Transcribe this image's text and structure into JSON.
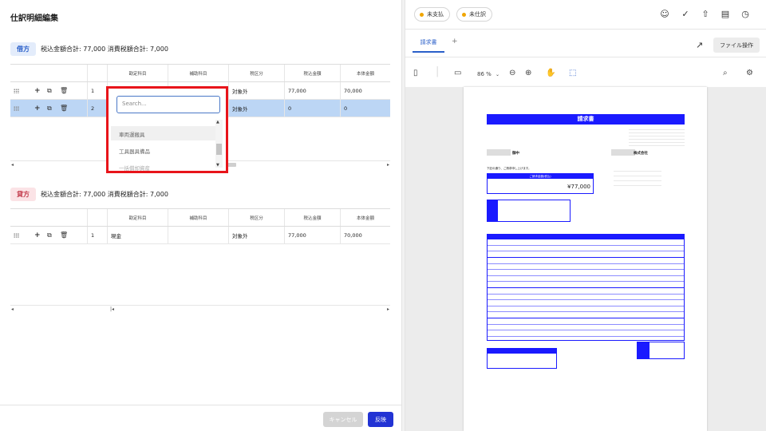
{
  "dialog": {
    "title": "仕訳明細編集",
    "cancel_label": "キャンセル",
    "apply_label": "反映"
  },
  "debit": {
    "badge": "借方",
    "summary": "税込金額合計: 77,000 消費税額合計: 7,000",
    "headers": [
      "勘定科目",
      "補助科目",
      "税区分",
      "税込金額",
      "本体金額"
    ],
    "rows": [
      {
        "no": "1",
        "account": "",
        "sub": "",
        "tax": "対象外",
        "amount": "77,000",
        "base": "70,000"
      },
      {
        "no": "2",
        "account": "",
        "sub": "",
        "tax": "対象外",
        "amount": "0",
        "base": "0"
      }
    ]
  },
  "credit": {
    "badge": "貸方",
    "summary": "税込金額合計: 77,000 消費税額合計: 7,000",
    "headers": [
      "勘定科目",
      "補助科目",
      "税区分",
      "税込金額",
      "本体金額"
    ],
    "rows": [
      {
        "no": "1",
        "account": "現金",
        "sub": "",
        "tax": "対象外",
        "amount": "77,000",
        "base": "70,000"
      }
    ]
  },
  "dropdown": {
    "placeholder": "Search...",
    "options": [
      "車両運搬具",
      "工具器具備品",
      "一括償却資産"
    ]
  },
  "viewer": {
    "chips": [
      "未支払",
      "未仕訳"
    ],
    "tab_label": "請求書",
    "file_ops_label": "ファイル操作",
    "zoom": "86 %",
    "document": {
      "title": "請求書",
      "recipient_suffix": "御中",
      "sender": "株式会社",
      "greeting": "下記の通り、ご請求申し上げます。",
      "amount_label": "ご請求金額(税込)",
      "amount": "¥77,000"
    }
  },
  "colors": {
    "accent": "#2233d4",
    "invoice_blue": "#1a1aff",
    "selected_row": "#bcd6f5",
    "highlight_border": "#e8141a"
  }
}
